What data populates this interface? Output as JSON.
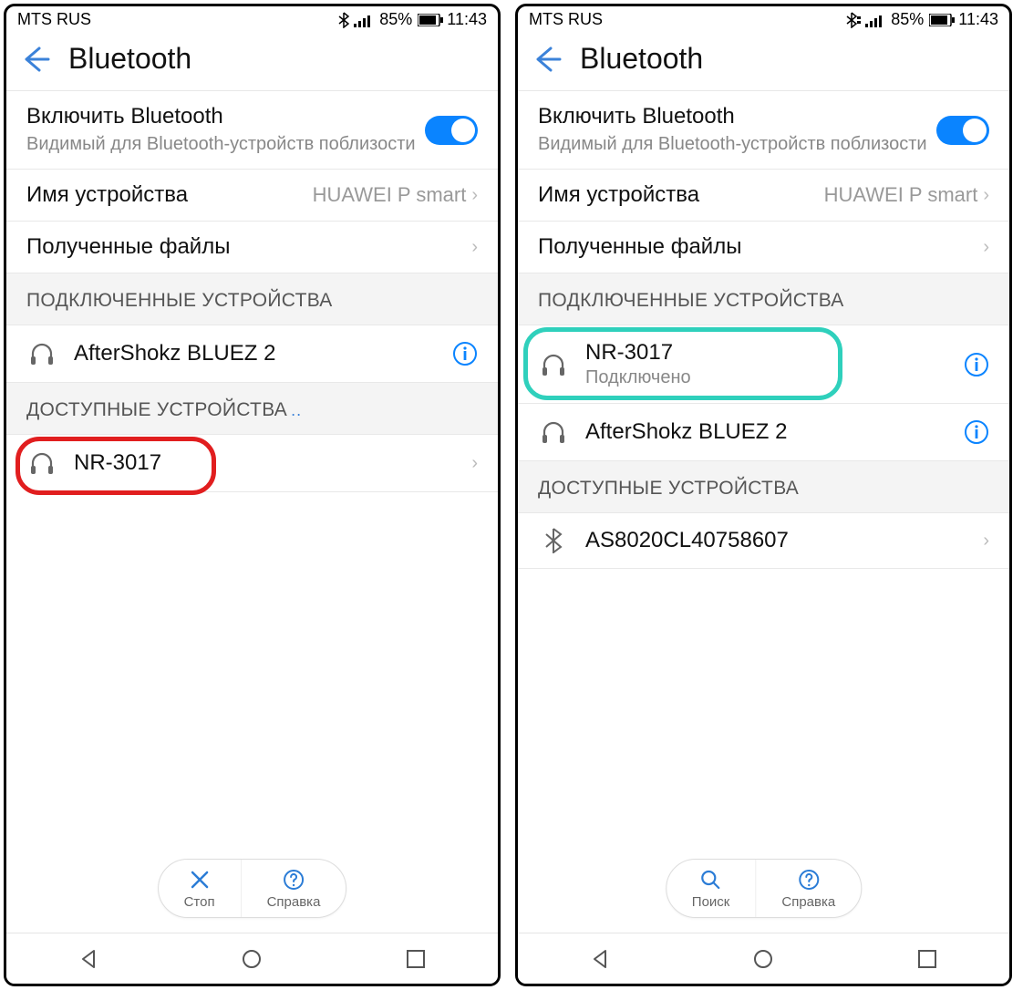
{
  "left": {
    "status": {
      "carrier": "MTS RUS",
      "battery": "85%",
      "time": "11:43"
    },
    "header": {
      "title": "Bluetooth"
    },
    "toggle": {
      "title": "Включить Bluetooth",
      "subtitle": "Видимый для Bluetooth-устройств поблизости"
    },
    "device_name_row": {
      "label": "Имя устройства",
      "value": "HUAWEI P smart"
    },
    "received_row": {
      "label": "Полученные файлы"
    },
    "section_connected": "ПОДКЛЮЧЕННЫЕ УСТРОЙСТВА",
    "connected": [
      {
        "name": "AfterShokz BLUEZ 2"
      }
    ],
    "section_available": "ДОСТУПНЫЕ УСТРОЙСТВА",
    "available": [
      {
        "name": "NR-3017"
      }
    ],
    "pill": {
      "stop": "Стоп",
      "help": "Справка"
    }
  },
  "right": {
    "status": {
      "carrier": "MTS RUS",
      "battery": "85%",
      "time": "11:43"
    },
    "header": {
      "title": "Bluetooth"
    },
    "toggle": {
      "title": "Включить Bluetooth",
      "subtitle": "Видимый для Bluetooth-устройств поблизости"
    },
    "device_name_row": {
      "label": "Имя устройства",
      "value": "HUAWEI P smart"
    },
    "received_row": {
      "label": "Полученные файлы"
    },
    "section_connected": "ПОДКЛЮЧЕННЫЕ УСТРОЙСТВА",
    "connected": [
      {
        "name": "NR-3017",
        "status": "Подключено"
      },
      {
        "name": "AfterShokz BLUEZ 2"
      }
    ],
    "section_available": "ДОСТУПНЫЕ УСТРОЙСТВА",
    "available": [
      {
        "name": "AS8020CL40758607"
      }
    ],
    "pill": {
      "search": "Поиск",
      "help": "Справка"
    }
  }
}
